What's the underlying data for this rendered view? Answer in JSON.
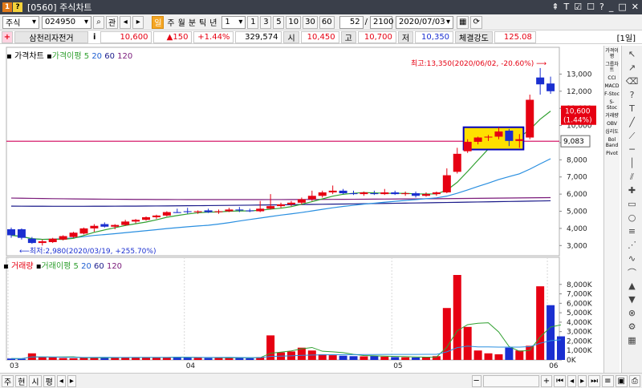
{
  "window": {
    "num1": "1",
    "num2": "?",
    "title": "[0560] 주식차트"
  },
  "toolbar": {
    "market": "주식",
    "code": "024950",
    "btn_gwan": "관",
    "period_tabs": [
      "일",
      "주",
      "월",
      "분",
      "틱",
      "년"
    ],
    "multi_select": "1",
    "intervals": [
      "1",
      "3",
      "5",
      "10",
      "30",
      "60"
    ],
    "count_current": "52",
    "count_total": "2100",
    "date": "2020/07/03"
  },
  "quote": {
    "stock_name": "삼천리자전거",
    "info_icon": "i",
    "price": "10,600",
    "change": "▲150",
    "change_pct": "+1.44%",
    "volume": "329,574",
    "open_label": "시",
    "open": "10,450",
    "high_label": "고",
    "high": "10,700",
    "low_label": "저",
    "low": "10,350",
    "strength_label": "체결강도",
    "strength": "125.08",
    "period_badge": "[1일]"
  },
  "price_legend": {
    "title": "가격차트",
    "ma_title": "가격이평",
    "ma": [
      "5",
      "20",
      "60",
      "120"
    ]
  },
  "volume_legend": {
    "title": "거래량",
    "ma_title": "거래이평",
    "ma": [
      "5",
      "20",
      "60",
      "120"
    ]
  },
  "annotations": {
    "max": "최고:13,350(2020/06/02, -20.60%)",
    "min": "최저:2,980(2020/03/19, +255.70%)",
    "current_price": "10,600",
    "current_pct": "(1.44%)",
    "hline_value": "9,083"
  },
  "right_indicators": [
    "가격이평",
    "그룹차트",
    "CCI",
    "MACD",
    "F-Stoc",
    "S-Stoc",
    "거래량",
    "OBV",
    "심리도",
    "Bol Band",
    "Pivot"
  ],
  "bottom": {
    "items": [
      "주",
      "현",
      "시",
      "평"
    ]
  },
  "colors": {
    "up": "#e60012",
    "down": "#1a2fd0",
    "ma5": "#30a030",
    "ma20": "#2a8fe0",
    "ma60": "#1a1a8a",
    "ma120": "#7a1a7a",
    "hline": "#d0005a",
    "highlight": "#ffe000"
  },
  "chart_data": [
    {
      "type": "candlestick",
      "title": "가격차트",
      "x_labels": [
        "03",
        "04",
        "05",
        "06"
      ],
      "ylim": [
        2500,
        14000
      ],
      "y_ticks": [
        "13,000",
        "12,000",
        "11,000",
        "10,000",
        "9,000",
        "8,000",
        "7,000",
        "6,000",
        "5,000",
        "4,000",
        "3,000"
      ],
      "candles": [
        {
          "o": 3950,
          "h": 4050,
          "l": 3450,
          "c": 3600
        },
        {
          "o": 3950,
          "h": 4000,
          "l": 3350,
          "c": 3450
        },
        {
          "o": 3400,
          "h": 3500,
          "l": 3100,
          "c": 3150
        },
        {
          "o": 3150,
          "h": 3350,
          "l": 3000,
          "c": 3250
        },
        {
          "o": 3200,
          "h": 3450,
          "l": 3150,
          "c": 3400
        },
        {
          "o": 3350,
          "h": 3600,
          "l": 3300,
          "c": 3550
        },
        {
          "o": 3500,
          "h": 3800,
          "l": 3450,
          "c": 3750
        },
        {
          "o": 3700,
          "h": 4050,
          "l": 3650,
          "c": 4000
        },
        {
          "o": 4000,
          "h": 4250,
          "l": 3800,
          "c": 4150
        },
        {
          "o": 4250,
          "h": 4350,
          "l": 4050,
          "c": 4100
        },
        {
          "o": 4100,
          "h": 4250,
          "l": 3950,
          "c": 4200
        },
        {
          "o": 4200,
          "h": 4500,
          "l": 4150,
          "c": 4400
        },
        {
          "o": 4400,
          "h": 4550,
          "l": 4300,
          "c": 4500
        },
        {
          "o": 4500,
          "h": 4700,
          "l": 4450,
          "c": 4650
        },
        {
          "o": 4650,
          "h": 4800,
          "l": 4550,
          "c": 4750
        },
        {
          "o": 4750,
          "h": 5000,
          "l": 4700,
          "c": 4950
        },
        {
          "o": 4950,
          "h": 5150,
          "l": 4900,
          "c": 4900
        },
        {
          "o": 5000,
          "h": 5200,
          "l": 4850,
          "c": 4950
        },
        {
          "o": 4950,
          "h": 5050,
          "l": 4850,
          "c": 5000
        },
        {
          "o": 5050,
          "h": 5150,
          "l": 4900,
          "c": 4950
        },
        {
          "o": 4950,
          "h": 5100,
          "l": 4850,
          "c": 5000
        },
        {
          "o": 5000,
          "h": 5200,
          "l": 4950,
          "c": 5100
        },
        {
          "o": 5100,
          "h": 5250,
          "l": 4950,
          "c": 5050
        },
        {
          "o": 5050,
          "h": 5150,
          "l": 4950,
          "c": 5000
        },
        {
          "o": 5000,
          "h": 5600,
          "l": 4950,
          "c": 5150
        },
        {
          "o": 5150,
          "h": 6000,
          "l": 5100,
          "c": 5300
        },
        {
          "o": 5300,
          "h": 5500,
          "l": 5200,
          "c": 5400
        },
        {
          "o": 5400,
          "h": 5600,
          "l": 5300,
          "c": 5500
        },
        {
          "o": 5500,
          "h": 5800,
          "l": 5400,
          "c": 5700
        },
        {
          "o": 5700,
          "h": 6200,
          "l": 5600,
          "c": 5900
        },
        {
          "o": 5900,
          "h": 6200,
          "l": 5800,
          "c": 6100
        },
        {
          "o": 6100,
          "h": 6500,
          "l": 6000,
          "c": 6200
        },
        {
          "o": 6200,
          "h": 6300,
          "l": 6000,
          "c": 6050
        },
        {
          "o": 6050,
          "h": 6200,
          "l": 5950,
          "c": 6000
        },
        {
          "o": 6000,
          "h": 6150,
          "l": 5900,
          "c": 6100
        },
        {
          "o": 6050,
          "h": 6200,
          "l": 5950,
          "c": 6000
        },
        {
          "o": 6000,
          "h": 6300,
          "l": 5950,
          "c": 6100
        },
        {
          "o": 6100,
          "h": 6200,
          "l": 5950,
          "c": 6000
        },
        {
          "o": 6000,
          "h": 6150,
          "l": 5900,
          "c": 6050
        },
        {
          "o": 6050,
          "h": 6150,
          "l": 5800,
          "c": 5900
        },
        {
          "o": 5900,
          "h": 6100,
          "l": 5850,
          "c": 6000
        },
        {
          "o": 6000,
          "h": 6150,
          "l": 5900,
          "c": 6100
        },
        {
          "o": 6100,
          "h": 7500,
          "l": 6050,
          "c": 7100
        },
        {
          "o": 7300,
          "h": 8700,
          "l": 7200,
          "c": 8350
        },
        {
          "o": 8500,
          "h": 9200,
          "l": 8400,
          "c": 9050
        },
        {
          "o": 9050,
          "h": 9350,
          "l": 8900,
          "c": 9300
        },
        {
          "o": 9300,
          "h": 9450,
          "l": 9100,
          "c": 9350
        },
        {
          "o": 9350,
          "h": 9900,
          "l": 9200,
          "c": 9650
        },
        {
          "o": 9700,
          "h": 9800,
          "l": 8800,
          "c": 9100
        },
        {
          "o": 9100,
          "h": 9500,
          "l": 8700,
          "c": 9200
        },
        {
          "o": 9300,
          "h": 11800,
          "l": 9200,
          "c": 11500
        },
        {
          "o": 12800,
          "h": 13350,
          "l": 11800,
          "c": 12400
        },
        {
          "o": 12450,
          "h": 12850,
          "l": 11850,
          "c": 12000
        }
      ],
      "ma5_end": 10800,
      "ma20_end": 7900,
      "ma60_end": 5600,
      "ma120_end": 5700
    },
    {
      "type": "bar",
      "title": "거래량",
      "ylim": [
        0,
        9000000
      ],
      "y_ticks": [
        "8,000K",
        "7,000K",
        "6,000K",
        "5,000K",
        "4,000K",
        "3,000K",
        "2,000K",
        "1,000K",
        "0K"
      ],
      "values": [
        150000,
        120000,
        700000,
        300000,
        260000,
        200000,
        180000,
        220000,
        300000,
        280000,
        250000,
        230000,
        260000,
        300000,
        280000,
        270000,
        320000,
        250000,
        220000,
        200000,
        230000,
        240000,
        260000,
        180000,
        300000,
        2600000,
        800000,
        900000,
        1300000,
        1000000,
        600000,
        500000,
        450000,
        400000,
        380000,
        420000,
        350000,
        300000,
        280000,
        260000,
        300000,
        400000,
        5500000,
        9000000,
        3500000,
        1000000,
        700000,
        600000,
        1300000,
        1000000,
        1500000,
        7800000,
        5800000,
        2500000
      ],
      "up": [
        0,
        0,
        1,
        1,
        1,
        1,
        1,
        1,
        1,
        0,
        1,
        1,
        1,
        1,
        1,
        1,
        0,
        0,
        1,
        0,
        1,
        1,
        0,
        0,
        1,
        1,
        1,
        1,
        1,
        1,
        1,
        1,
        0,
        0,
        1,
        0,
        1,
        0,
        1,
        0,
        1,
        1,
        1,
        1,
        1,
        1,
        1,
        1,
        0,
        1,
        1,
        1,
        0,
        0
      ]
    }
  ]
}
